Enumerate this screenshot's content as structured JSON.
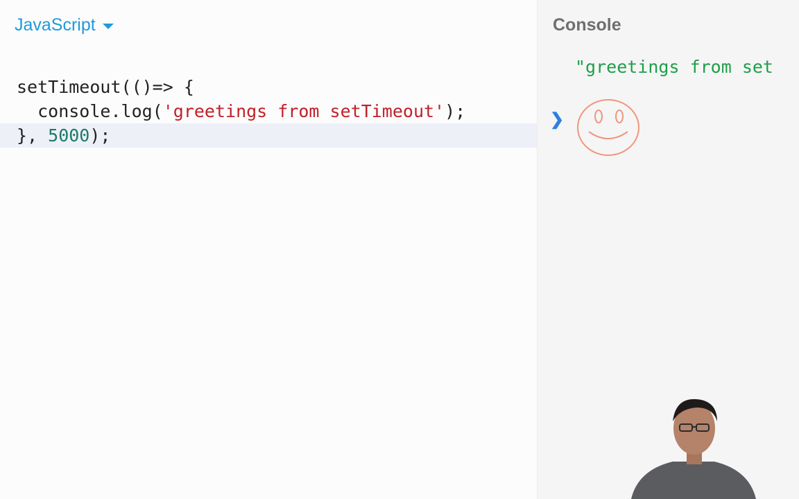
{
  "editor": {
    "language": "JavaScript",
    "lines": [
      {
        "parts": [
          {
            "t": "setTimeout(()=> {",
            "c": "plain"
          }
        ]
      },
      {
        "parts": [
          {
            "t": "  console.log(",
            "c": "plain"
          },
          {
            "t": "'greetings from setTimeout'",
            "c": "str"
          },
          {
            "t": ");",
            "c": "plain"
          }
        ]
      },
      {
        "parts": [
          {
            "t": "}, ",
            "c": "plain"
          },
          {
            "t": "5000",
            "c": "num"
          },
          {
            "t": ");",
            "c": "plain"
          }
        ]
      }
    ]
  },
  "console": {
    "title": "Console",
    "output": "\"greetings from set",
    "prompt_icon": "chevron-right-icon"
  },
  "colors": {
    "accent": "#1d9bd9",
    "string": "#c0202a",
    "number": "#1c7a68",
    "console_output": "#1e9e4a",
    "prompt": "#2e7fe0",
    "annotation": "#f0957f"
  }
}
